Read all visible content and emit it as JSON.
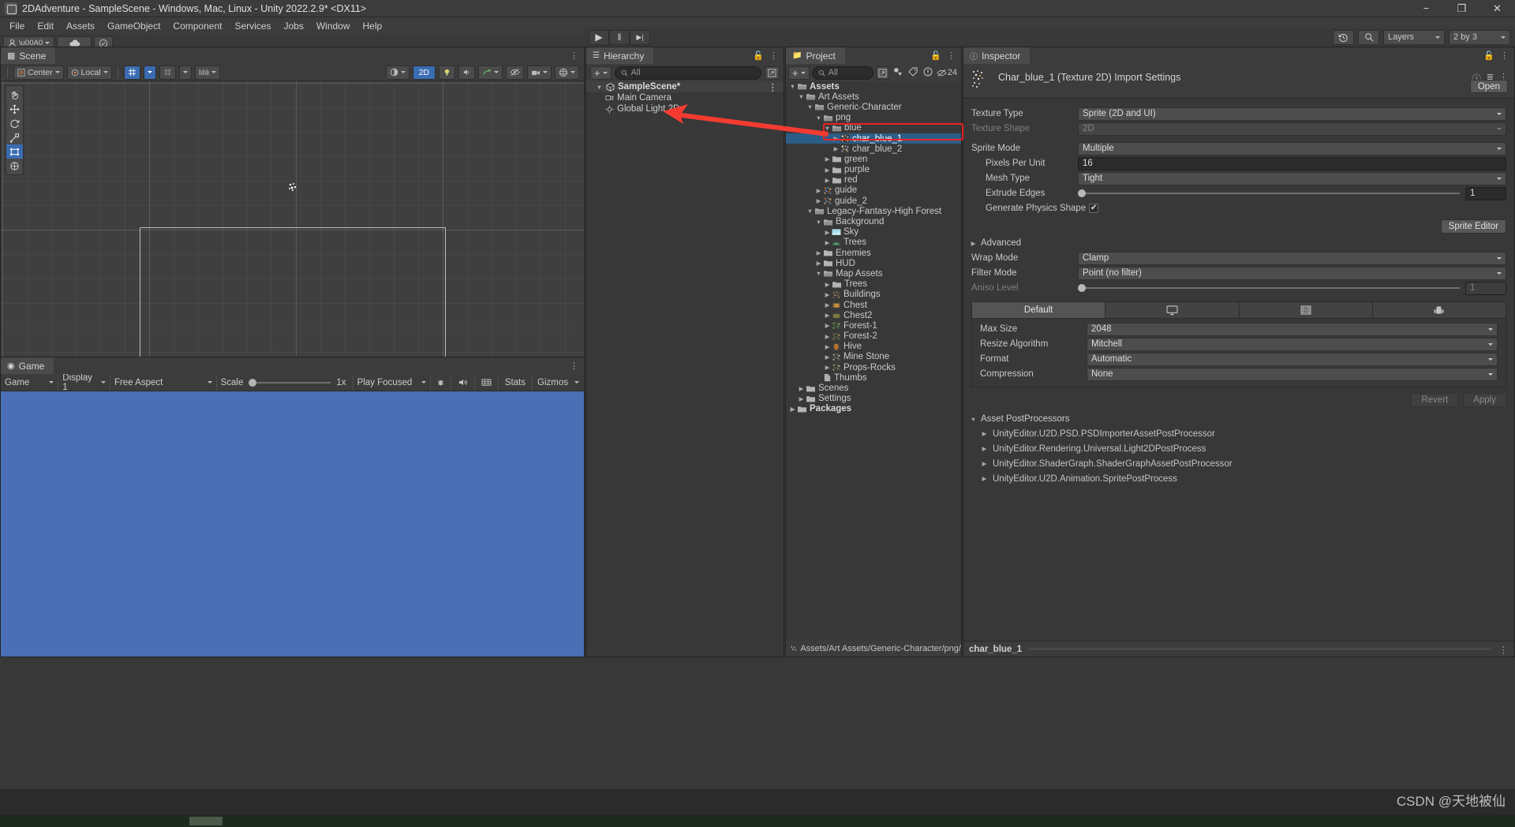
{
  "window": {
    "title": "2DAdventure - SampleScene - Windows, Mac, Linux - Unity 2022.2.9* <DX11>",
    "minimize": "−",
    "maximize": "❐",
    "close": "✕"
  },
  "menubar": {
    "items": [
      "File",
      "Edit",
      "Assets",
      "GameObject",
      "Component",
      "Services",
      "Jobs",
      "Window",
      "Help"
    ]
  },
  "toolbar_right": {
    "history_icon": "history-icon",
    "search_icon": "search-icon",
    "layers_label": "Layers",
    "layout_label": "2 by 3"
  },
  "playbar": {
    "play": "▶",
    "pause": "‖",
    "step": "▶|"
  },
  "scene": {
    "tab_label": "Scene",
    "pivot_label": "Center",
    "space_label": "Local",
    "grid_icon": "grid-icon",
    "snap_icon": "snap-icon",
    "ruler_icon": "ruler-icon",
    "toggle_2d": "2D",
    "light_icon": "lighting-icon",
    "audio_icon": "audio-icon",
    "fx_icon": "effects-icon",
    "hidden_icon": "hidden-objects-icon",
    "camera_icon": "scene-camera-icon",
    "gizmos_icon": "gizmos-icon",
    "tools": [
      "hand-tool",
      "move-tool",
      "rotate-tool",
      "scale-tool",
      "rect-tool",
      "transform-tool"
    ]
  },
  "game": {
    "tab_label": "Game",
    "target_label": "Game",
    "display_label": "Display 1",
    "aspect_label": "Free Aspect",
    "scale_label": "Scale",
    "scale_value": "1x",
    "play_mode_label": "Play Focused",
    "mute_icon": "mute-audio-icon",
    "stats_label": "Stats",
    "gizmos_label": "Gizmos"
  },
  "hierarchy": {
    "tab_label": "Hierarchy",
    "add_label": "+",
    "search_placeholder": "All",
    "scene_name": "SampleScene*",
    "items": [
      {
        "label": "Main Camera",
        "icon": "camera-icon"
      },
      {
        "label": "Global Light 2D",
        "icon": "light-icon"
      }
    ]
  },
  "project": {
    "tab_label": "Project",
    "add_label": "+",
    "search_placeholder": "All",
    "badge_count": "24",
    "footer_path": "Assets/Art Assets/Generic-Character/png/blu",
    "tree": [
      {
        "label": "Assets",
        "depth": 0,
        "tri": "down",
        "icon": "folder-open",
        "bold": true
      },
      {
        "label": "Art Assets",
        "depth": 1,
        "tri": "down",
        "icon": "folder-open"
      },
      {
        "label": "Generic-Character",
        "depth": 2,
        "tri": "down",
        "icon": "folder-open"
      },
      {
        "label": "png",
        "depth": 3,
        "tri": "down",
        "icon": "folder-open"
      },
      {
        "label": "blue",
        "depth": 4,
        "tri": "down",
        "icon": "folder-open"
      },
      {
        "label": "char_blue_1",
        "depth": 5,
        "tri": "right",
        "icon": "sprite",
        "selected": true
      },
      {
        "label": "char_blue_2",
        "depth": 5,
        "tri": "right",
        "icon": "sprite"
      },
      {
        "label": "green",
        "depth": 4,
        "tri": "right",
        "icon": "folder"
      },
      {
        "label": "purple",
        "depth": 4,
        "tri": "right",
        "icon": "folder"
      },
      {
        "label": "red",
        "depth": 4,
        "tri": "right",
        "icon": "folder"
      },
      {
        "label": "guide",
        "depth": 3,
        "tri": "right",
        "icon": "sprite-guide"
      },
      {
        "label": "guide_2",
        "depth": 3,
        "tri": "right",
        "icon": "sprite-guide"
      },
      {
        "label": "Legacy-Fantasy-High Forest",
        "depth": 2,
        "tri": "down",
        "icon": "folder-open"
      },
      {
        "label": "Background",
        "depth": 3,
        "tri": "down",
        "icon": "folder-open"
      },
      {
        "label": "Sky",
        "depth": 4,
        "tri": "right",
        "icon": "sprite-sky"
      },
      {
        "label": "Trees",
        "depth": 4,
        "tri": "right",
        "icon": "sprite-trees"
      },
      {
        "label": "Enemies",
        "depth": 3,
        "tri": "right",
        "icon": "folder"
      },
      {
        "label": "HUD",
        "depth": 3,
        "tri": "right",
        "icon": "folder"
      },
      {
        "label": "Map Assets",
        "depth": 3,
        "tri": "down",
        "icon": "folder-open"
      },
      {
        "label": "Trees",
        "depth": 4,
        "tri": "right",
        "icon": "folder"
      },
      {
        "label": "Buildings",
        "depth": 4,
        "tri": "right",
        "icon": "sprite-buildings"
      },
      {
        "label": "Chest",
        "depth": 4,
        "tri": "right",
        "icon": "sprite-chest"
      },
      {
        "label": "Chest2",
        "depth": 4,
        "tri": "right",
        "icon": "sprite-chest2"
      },
      {
        "label": "Forest-1",
        "depth": 4,
        "tri": "right",
        "icon": "sprite-forest1"
      },
      {
        "label": "Forest-2",
        "depth": 4,
        "tri": "right",
        "icon": "sprite-forest2"
      },
      {
        "label": "Hive",
        "depth": 4,
        "tri": "right",
        "icon": "sprite-hive"
      },
      {
        "label": "Mine Stone",
        "depth": 4,
        "tri": "right",
        "icon": "sprite-mine"
      },
      {
        "label": "Props-Rocks",
        "depth": 4,
        "tri": "right",
        "icon": "sprite-rocks"
      },
      {
        "label": "Thumbs",
        "depth": 3,
        "tri": "none",
        "icon": "file"
      },
      {
        "label": "Scenes",
        "depth": 1,
        "tri": "right",
        "icon": "folder"
      },
      {
        "label": "Settings",
        "depth": 1,
        "tri": "right",
        "icon": "folder"
      },
      {
        "label": "Packages",
        "depth": 0,
        "tri": "right",
        "icon": "folder",
        "bold": true
      }
    ]
  },
  "inspector": {
    "tab_label": "Inspector",
    "asset_title": "Char_blue_1 (Texture 2D) Import Settings",
    "help_icon": "help-icon",
    "preset_icon": "preset-icon",
    "menu_icon": "kebab-menu-icon",
    "open_button": "Open",
    "fields": {
      "texture_type_label": "Texture Type",
      "texture_type_value": "Sprite (2D and UI)",
      "texture_shape_label": "Texture Shape",
      "texture_shape_value": "2D",
      "sprite_mode_label": "Sprite Mode",
      "sprite_mode_value": "Multiple",
      "pixels_per_unit_label": "Pixels Per Unit",
      "pixels_per_unit_value": "16",
      "mesh_type_label": "Mesh Type",
      "mesh_type_value": "Tight",
      "extrude_edges_label": "Extrude Edges",
      "extrude_edges_value": "1",
      "generate_physics_label": "Generate Physics Shape",
      "generate_physics_checked": "✔",
      "sprite_editor_button": "Sprite Editor",
      "advanced_label": "Advanced",
      "wrap_mode_label": "Wrap Mode",
      "wrap_mode_value": "Clamp",
      "filter_mode_label": "Filter Mode",
      "filter_mode_value": "Point (no filter)",
      "aniso_level_label": "Aniso Level",
      "aniso_level_value": "1"
    },
    "platform_tabs": [
      {
        "label": "Default",
        "icon": "default-icon",
        "active": true
      },
      {
        "label": "",
        "icon": "standalone-monitor-icon",
        "active": false
      },
      {
        "label": "",
        "icon": "webgl-icon",
        "active": false
      },
      {
        "label": "",
        "icon": "android-icon",
        "active": false
      }
    ],
    "platform_fields": [
      {
        "label": "Max Size",
        "value": "2048"
      },
      {
        "label": "Resize Algorithm",
        "value": "Mitchell"
      },
      {
        "label": "Format",
        "value": "Automatic"
      },
      {
        "label": "Compression",
        "value": "None"
      }
    ],
    "revert_button": "Revert",
    "apply_button": "Apply",
    "post_processors_header": "Asset PostProcessors",
    "post_processors": [
      "UnityEditor.U2D.PSD.PSDImporterAssetPostProcessor",
      "UnityEditor.Rendering.Universal.Light2DPostProcess",
      "UnityEditor.ShaderGraph.ShaderGraphAssetPostProcessor",
      "UnityEditor.U2D.Animation.SpritePostProcess"
    ],
    "selected_asset_name": "char_blue_1"
  },
  "watermark": "CSDN @天地被仙",
  "colors": {
    "accent_blue": "#2c5d87",
    "annotation_red": "#ee2222",
    "game_bg": "#4a6fb5",
    "panel_bg": "#383838",
    "toolbar_bg": "#3c3c3c"
  }
}
